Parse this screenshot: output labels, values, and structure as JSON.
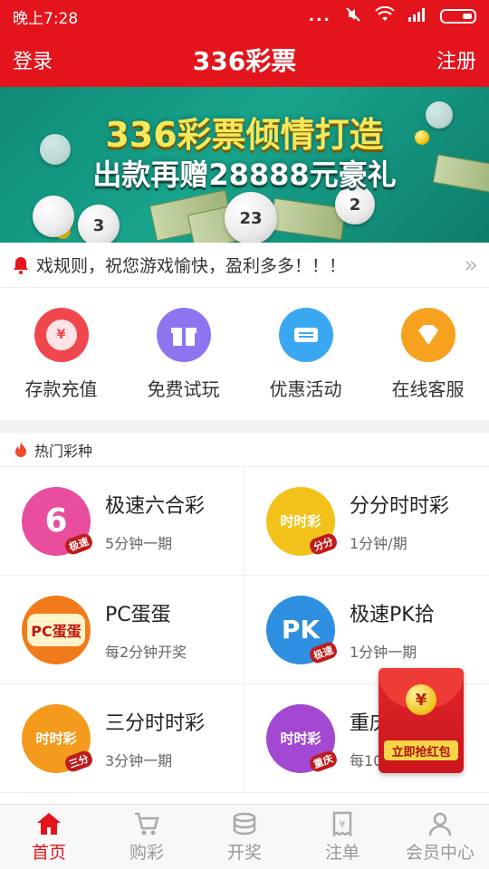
{
  "status_bar": {
    "time": "晚上7:28",
    "dots": "..."
  },
  "header": {
    "login": "登录",
    "title": "336彩票",
    "register": "注册"
  },
  "banner": {
    "line1": "336彩票倾情打造",
    "line2": "出款再赠28888元豪礼",
    "balls": [
      "2",
      "3",
      "23"
    ]
  },
  "notice": {
    "text": "戏规则，祝您游戏愉快，盈利多多！！！"
  },
  "quick_actions": [
    {
      "label": "存款充值",
      "icon": "deposit-icon",
      "color": "#f0474f"
    },
    {
      "label": "免费试玩",
      "icon": "gift-icon",
      "color": "#8f74f0"
    },
    {
      "label": "优惠活动",
      "icon": "ticket-icon",
      "color": "#3aa7f2"
    },
    {
      "label": "在线客服",
      "icon": "diamond-icon",
      "color": "#f7a21f"
    }
  ],
  "hot": {
    "title": "热门彩种",
    "games": [
      {
        "name": "极速六合彩",
        "sub": "5分钟一期",
        "icon_text": "6",
        "tag": "极速",
        "color": "#e84d9e"
      },
      {
        "name": "分分时时彩",
        "sub": "1分钟/期",
        "icon_text": "时时彩",
        "tag": "分分",
        "color": "#f2c21b"
      },
      {
        "name": "PC蛋蛋",
        "sub": "每2分钟开奖",
        "icon_text": "PC蛋蛋",
        "tag": "",
        "color": "#f17a1b"
      },
      {
        "name": "极速PK拾",
        "sub": "1分钟一期",
        "icon_text": "PK",
        "tag": "极速",
        "color": "#2e8fe0"
      },
      {
        "name": "三分时时彩",
        "sub": "3分钟一期",
        "icon_text": "时时彩",
        "tag": "三分",
        "color": "#f49a1d"
      },
      {
        "name": "重庆",
        "sub": "每10",
        "icon_text": "时时彩",
        "tag": "重庆",
        "color": "#a348d3"
      }
    ]
  },
  "red_envelope": {
    "symbol": "¥",
    "button": "立即抢红包"
  },
  "bottom_nav": [
    {
      "label": "首页",
      "icon": "home-icon",
      "active": true
    },
    {
      "label": "购彩",
      "icon": "cart-icon",
      "active": false
    },
    {
      "label": "开奖",
      "icon": "coins-icon",
      "active": false
    },
    {
      "label": "注单",
      "icon": "receipt-icon",
      "active": false
    },
    {
      "label": "会员中心",
      "icon": "user-icon",
      "active": false
    }
  ],
  "colors": {
    "brand": "#e3141c",
    "banner": "#18a48c"
  }
}
